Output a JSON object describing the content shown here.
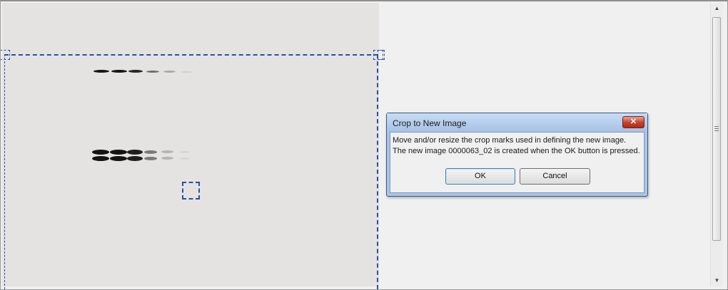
{
  "dialog": {
    "title": "Crop to New Image",
    "close_label": "✕",
    "message_line1": "Move and/or resize the crop marks used in defining the new image.",
    "message_line2": "The new image 0000063_02 is created when the OK button is pressed.",
    "ok_label": "OK",
    "cancel_label": "Cancel"
  },
  "scrollbar": {
    "up_icon": "▲",
    "down_icon": "▼"
  },
  "colors": {
    "crop_mark": "#2e4fa6",
    "gel_background": "#e4e3e2",
    "dialog_frame": "#a9c4e6",
    "close_button": "#c6402c"
  }
}
